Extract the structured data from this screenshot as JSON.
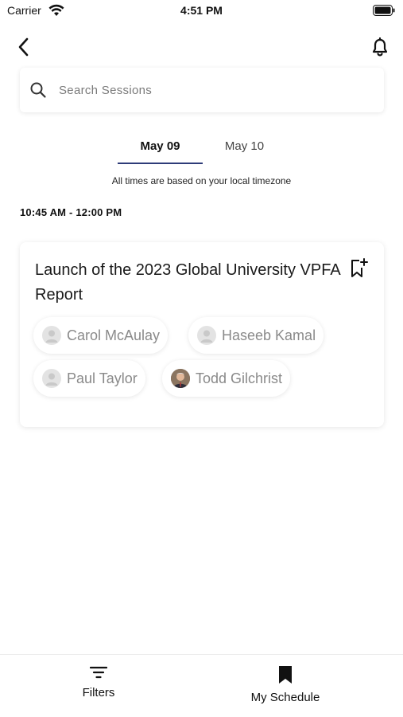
{
  "status_bar": {
    "carrier": "Carrier",
    "time": "4:51 PM"
  },
  "search": {
    "placeholder": "Search Sessions",
    "value": ""
  },
  "tabs": [
    {
      "label": "May 09",
      "active": true
    },
    {
      "label": "May 10",
      "active": false
    }
  ],
  "timezone_note": "All times are based on your local timezone",
  "slot": {
    "time": "10:45 AM - 12:00 PM"
  },
  "session": {
    "title": "Launch of the 2023 Global University VPFA Report",
    "speakers": [
      {
        "name": "Carol McAulay",
        "avatar": "placeholder"
      },
      {
        "name": "Haseeb Kamal",
        "avatar": "placeholder"
      },
      {
        "name": "Paul Taylor",
        "avatar": "placeholder"
      },
      {
        "name": "Todd Gilchrist",
        "avatar": "photo"
      }
    ]
  },
  "bottom_nav": {
    "filters_label": "Filters",
    "schedule_label": "My Schedule"
  },
  "colors": {
    "accent": "#2e3b78",
    "text": "#111111",
    "muted": "#8a8a8a"
  }
}
